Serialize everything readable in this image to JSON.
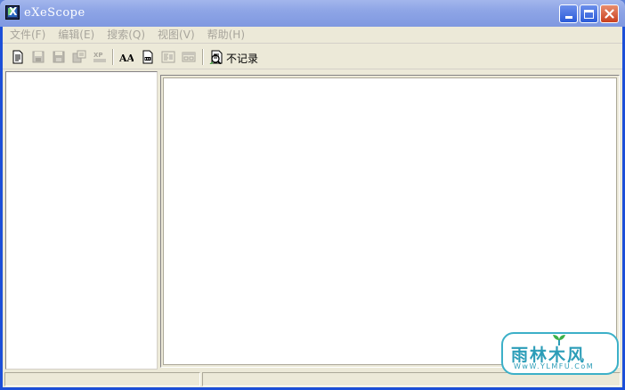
{
  "window": {
    "title": "eXeScope"
  },
  "menu": {
    "items": [
      {
        "label": "文件(F)"
      },
      {
        "label": "编辑(E)"
      },
      {
        "label": "搜索(Q)"
      },
      {
        "label": "视图(V)"
      },
      {
        "label": "帮助(H)"
      }
    ]
  },
  "toolbar": {
    "log_label": "不记录",
    "xp_label": "XP",
    "font_label": "AA",
    "tools": [
      {
        "icon": "open-file-icon"
      },
      {
        "icon": "save-icon"
      },
      {
        "icon": "save-as-icon"
      },
      {
        "icon": "export-icon"
      },
      {
        "icon": "xp-style-icon"
      },
      {
        "icon": "font-icon"
      },
      {
        "icon": "binary-view-icon"
      },
      {
        "icon": "dialog-view-icon"
      },
      {
        "icon": "form-view-icon"
      },
      {
        "icon": "log-icon"
      }
    ]
  },
  "watermark": {
    "brand_cn": "雨林木风",
    "url": "WwW.YLMFU.CoM"
  },
  "colors": {
    "title_bar": "#8ea5e6",
    "frame": "#1c4fd8",
    "face": "#ece9d8",
    "disabled_text": "#a8a59c",
    "watermark": "#2c9db8"
  }
}
